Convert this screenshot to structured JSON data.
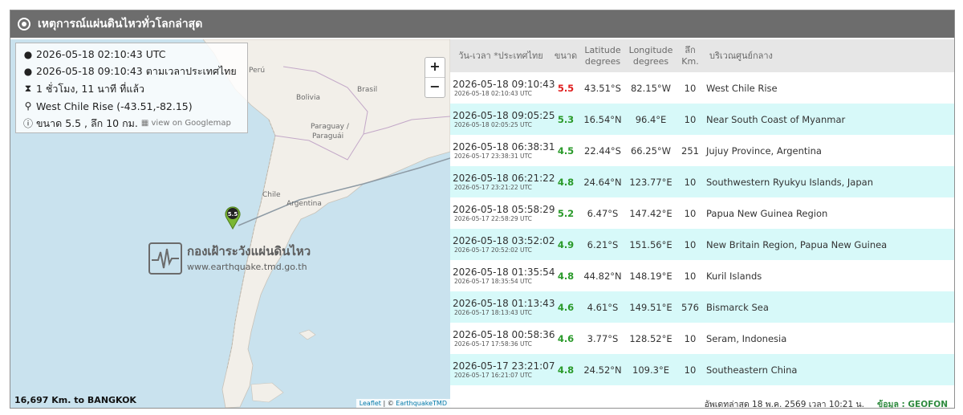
{
  "title": "เหตุการณ์แผ่นดินไหวทั่วโลกล่าสุด",
  "info": {
    "utc_time": "2026-05-18 02:10:43 UTC",
    "thai_time": "2026-05-18 09:10:43 ตามเวลาประเทศไทย",
    "ago": "1 ชั่วโมง, 11 นาที ที่แล้ว",
    "location": "West Chile Rise (-43.51,-82.15)",
    "magnitude_depth": "ขนาด 5.5 , ลึก 10 กม.",
    "map_link": "view on Googlemap"
  },
  "map": {
    "labels": {
      "peru": "Perú",
      "bolivia": "Bolivia",
      "brasil": "Brasil",
      "paraguay_1": "Paraguay /",
      "paraguay_2": "Paraguái",
      "chile": "Chile",
      "argentina": "Argentina"
    },
    "zoom_in": "+",
    "zoom_out": "−",
    "marker_label": "5.5",
    "logo_line1": "กองเฝ้าระวังแผ่นดินไหว",
    "logo_line2": "www.earthquake.tmd.go.th",
    "distance": "16,697 Km. to BANGKOK",
    "attribution_leaflet": "Leaflet",
    "attribution_sep": " | © ",
    "attribution_owner": "EarthquakeTMD"
  },
  "table": {
    "headers": {
      "datetime": "วัน-เวลา *ประเทศไทย",
      "magnitude": "ขนาด",
      "lat_1": "Latitude",
      "lat_2": "degrees",
      "lon_1": "Longitude",
      "lon_2": "degrees",
      "depth_1": "ลึก",
      "depth_2": "Km.",
      "region": "บริเวณศูนย์กลาง"
    },
    "rows": [
      {
        "thai": "2026-05-18 09:10:43",
        "utc": "2026-05-18 02:10:43 UTC",
        "mag": "5.5",
        "mag_color": "#e02020",
        "lat": "43.51°S",
        "lon": "82.15°W",
        "depth": "10",
        "region": "West Chile Rise"
      },
      {
        "thai": "2026-05-18 09:05:25",
        "utc": "2026-05-18 02:05:25 UTC",
        "mag": "5.3",
        "mag_color": "#2a9a2a",
        "lat": "16.54°N",
        "lon": "96.4°E",
        "depth": "10",
        "region": "Near South Coast of Myanmar"
      },
      {
        "thai": "2026-05-18 06:38:31",
        "utc": "2026-05-17 23:38:31 UTC",
        "mag": "4.5",
        "mag_color": "#2a9a2a",
        "lat": "22.44°S",
        "lon": "66.25°W",
        "depth": "251",
        "region": "Jujuy Province, Argentina"
      },
      {
        "thai": "2026-05-18 06:21:22",
        "utc": "2026-05-17 23:21:22 UTC",
        "mag": "4.8",
        "mag_color": "#2a9a2a",
        "lat": "24.64°N",
        "lon": "123.77°E",
        "depth": "10",
        "region": "Southwestern Ryukyu Islands, Japan"
      },
      {
        "thai": "2026-05-18 05:58:29",
        "utc": "2026-05-17 22:58:29 UTC",
        "mag": "5.2",
        "mag_color": "#2a9a2a",
        "lat": "6.47°S",
        "lon": "147.42°E",
        "depth": "10",
        "region": "Papua New Guinea Region"
      },
      {
        "thai": "2026-05-18 03:52:02",
        "utc": "2026-05-17 20:52:02 UTC",
        "mag": "4.9",
        "mag_color": "#2a9a2a",
        "lat": "6.21°S",
        "lon": "151.56°E",
        "depth": "10",
        "region": "New Britain Region, Papua New Guinea"
      },
      {
        "thai": "2026-05-18 01:35:54",
        "utc": "2026-05-17 18:35:54 UTC",
        "mag": "4.8",
        "mag_color": "#2a9a2a",
        "lat": "44.82°N",
        "lon": "148.19°E",
        "depth": "10",
        "region": "Kuril Islands"
      },
      {
        "thai": "2026-05-18 01:13:43",
        "utc": "2026-05-17 18:13:43 UTC",
        "mag": "4.6",
        "mag_color": "#2a9a2a",
        "lat": "4.61°S",
        "lon": "149.51°E",
        "depth": "576",
        "region": "Bismarck Sea"
      },
      {
        "thai": "2026-05-18 00:58:36",
        "utc": "2026-05-17 17:58:36 UTC",
        "mag": "4.6",
        "mag_color": "#2a9a2a",
        "lat": "3.77°S",
        "lon": "128.52°E",
        "depth": "10",
        "region": "Seram, Indonesia"
      },
      {
        "thai": "2026-05-17 23:21:07",
        "utc": "2026-05-17 16:21:07 UTC",
        "mag": "4.8",
        "mag_color": "#2a9a2a",
        "lat": "24.52°N",
        "lon": "109.3°E",
        "depth": "10",
        "region": "Southeastern China"
      }
    ]
  },
  "footer": {
    "updated": "อัพเดทล่าสุด 18 พ.ค. 2569 เวลา 10:21 น.",
    "source": "ข้อมูล : GEOFON"
  },
  "colors": {
    "title_bar": "#6d6d6d",
    "row_alt": "#d7f9f9",
    "mag_high": "#e02020",
    "mag_normal": "#2a9a2a",
    "source_text": "#2f8b3f"
  },
  "icons": [
    "clock-icon",
    "user-clock-icon",
    "map-marker-icon",
    "info-icon",
    "image-icon",
    "seismograph-icon"
  ]
}
